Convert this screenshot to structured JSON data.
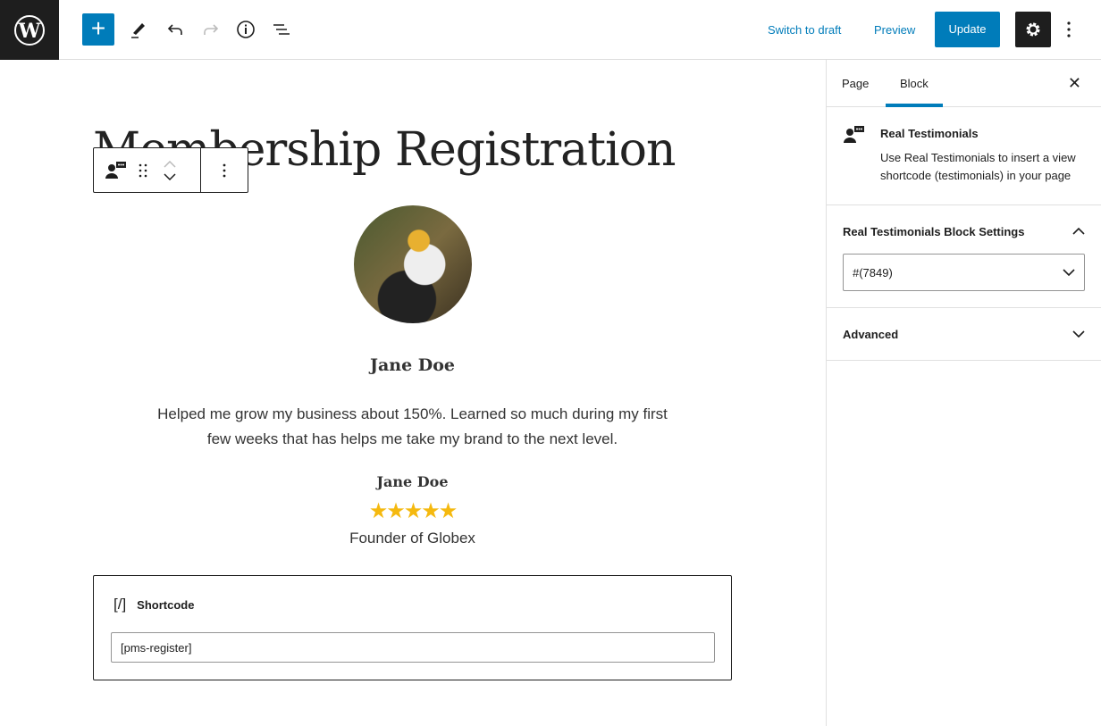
{
  "header": {
    "switch_to_draft": "Switch to draft",
    "preview": "Preview",
    "update": "Update"
  },
  "colors": {
    "accent": "#007cba",
    "dark": "#1e1e1e",
    "stars": "#f5b90f"
  },
  "editor": {
    "title": "Membership Registration",
    "testimonial": {
      "heading_name": "Jane Doe",
      "quote": "Helped me grow my business about 150%. Learned so much during my first few weeks that has helps me take my brand to the next level.",
      "author": "Jane Doe",
      "rating": 5,
      "rating_max": 5,
      "role": "Founder of Globex"
    },
    "shortcode": {
      "label": "Shortcode",
      "icon": "[/]",
      "value": "[pms-register]"
    }
  },
  "sidebar": {
    "tabs": [
      {
        "label": "Page"
      },
      {
        "label": "Block",
        "active": true
      }
    ],
    "block": {
      "name": "Real Testimonials",
      "description": "Use Real Testimonials to insert a view shortcode (testimonials) in your page"
    },
    "settings": {
      "title": "Real Testimonials Block Settings",
      "selected": "#(7849)"
    },
    "advanced": {
      "title": "Advanced"
    }
  }
}
